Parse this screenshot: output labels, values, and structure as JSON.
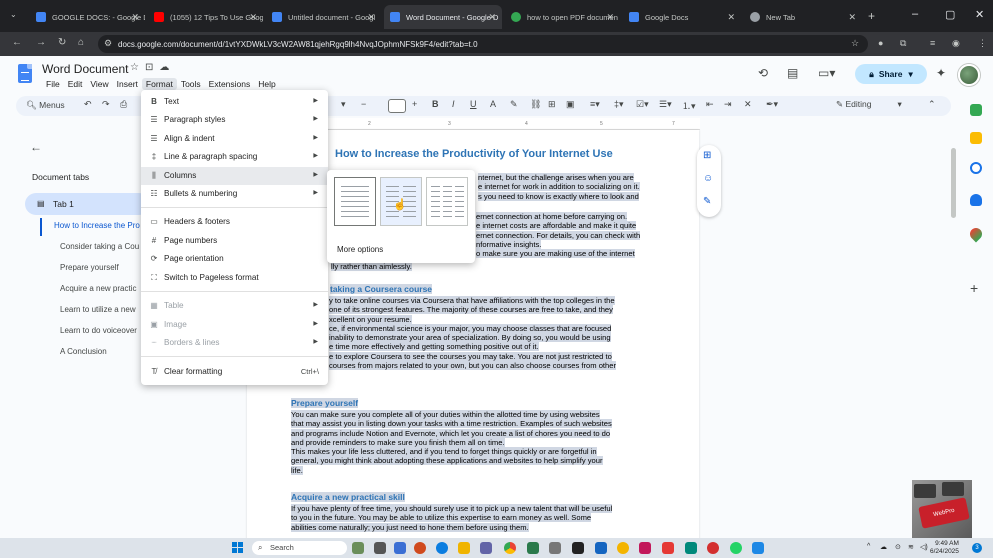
{
  "browser": {
    "tabs": [
      {
        "title": "GOOGLE DOCS: - Google D",
        "fav": "#4285f4"
      },
      {
        "title": "(1055) 12 Tips To Use Goog",
        "fav": "#ff0000"
      },
      {
        "title": "Untitled document - Googl",
        "fav": "#4285f4"
      },
      {
        "title": "Word Document - Google D",
        "fav": "#4285f4"
      },
      {
        "title": "how to open PDF documen",
        "fav": "#34a853"
      },
      {
        "title": "Google Docs",
        "fav": "#4285f4"
      },
      {
        "title": "New Tab",
        "fav": "#9aa0a6"
      }
    ],
    "url": "docs.google.com/document/d/1vtYXDWkLV3cW2AW81qjehRgq9lh4NvqJOphmNFSk9F4/edit?tab=t.0"
  },
  "docs": {
    "title": "Word Document",
    "menus": [
      "File",
      "Edit",
      "View",
      "Insert",
      "Format",
      "Tools",
      "Extensions",
      "Help"
    ],
    "share_label": "Share",
    "menus_search": "Menus",
    "editing_label": "Editing"
  },
  "sidebar": {
    "heading": "Document tabs",
    "tab1": "Tab 1",
    "outline": [
      "How to Increase the Pro",
      "Consider taking a Cou",
      "Prepare yourself",
      "Acquire a new practic",
      "Learn to utilize a new",
      "Learn to do voiceover",
      "A Conclusion"
    ]
  },
  "format_menu": {
    "items": [
      {
        "label": "Text",
        "icon": "B",
        "arrow": true
      },
      {
        "label": "Paragraph styles",
        "icon": "☰",
        "arrow": true
      },
      {
        "label": "Align & indent",
        "icon": "☰",
        "arrow": true
      },
      {
        "label": "Line & paragraph spacing",
        "icon": "‡",
        "arrow": true
      },
      {
        "label": "Columns",
        "icon": "⫼",
        "arrow": true
      },
      {
        "label": "Bullets & numbering",
        "icon": "☷",
        "arrow": true
      },
      {
        "label": "Headers & footers",
        "icon": "▭"
      },
      {
        "label": "Page numbers",
        "icon": "#"
      },
      {
        "label": "Page orientation",
        "icon": "⟳"
      },
      {
        "label": "Switch to Pageless format",
        "icon": "⛶"
      },
      {
        "label": "Table",
        "icon": "▦",
        "arrow": true
      },
      {
        "label": "Image",
        "icon": "▣",
        "arrow": true
      },
      {
        "label": "Borders & lines",
        "icon": "┈",
        "arrow": true
      },
      {
        "label": "Clear formatting",
        "icon": "T̸",
        "shortcut": "Ctrl+\\"
      }
    ]
  },
  "columns_submenu": {
    "more_options": "More options"
  },
  "document": {
    "heading": "How to Increase the Productivity of Your Internet Use",
    "p1": [
      "nternet, but the challenge arises when you are",
      "e internet for work in addition to socializing on it.",
      "s you need to know is exactly where to look and"
    ],
    "p2": [
      "ernet connection at home before carrying on.",
      "e internet costs are affordable and make it quite",
      "ernet connection. For details, you can check with",
      "nformative insights.",
      "o make sure you are making use of the internet",
      "lly rather than aimlessly."
    ],
    "sub1": "taking a Coursera course",
    "p3": [
      "y to take online courses via Coursera that have affiliations with the top colleges in the",
      "one of its strongest features. The majority of these courses are free to take, and they",
      "xcellent on your resume.",
      "ce, if environmental science is your major, you may choose classes that are focused",
      "inability to demonstrate your area of specialization. By doing so, you would be using",
      "e time more effectively and getting something positive out of it.",
      "e to explore Coursera to see the courses you may take. You are not just restricted to",
      "courses from majors related to your own, but you can also choose courses from other"
    ],
    "sub2": "Prepare yourself",
    "p4": [
      "You can make sure you complete all of your duties within the allotted time by using websites",
      "that may assist you in listing down your tasks with a time restriction. Examples of such websites",
      "and programs include Notion and Evernote, which let you create a list of chores you need to do",
      "and provide reminders to make sure you finish them all on time.",
      "This makes your life less cluttered, and if you tend to forget things quickly or are forgetful in",
      "general, you might think about adopting these applications and websites to help simplify your",
      "life."
    ],
    "sub3": "Acquire a new practical skill",
    "p5": [
      "If you have plenty of free time, you should surely use it to pick up a new talent that will be useful",
      "to you in the future. You may be able to utilize this expertise to earn money as well. Some",
      "abilities come naturally; you just need to hone them before using them."
    ]
  },
  "taskbar": {
    "search_label": "Search",
    "time": "9:49 AM",
    "date": "6/24/2025",
    "notif_count": "3"
  },
  "webcam": {
    "key_label": "WebPro"
  }
}
